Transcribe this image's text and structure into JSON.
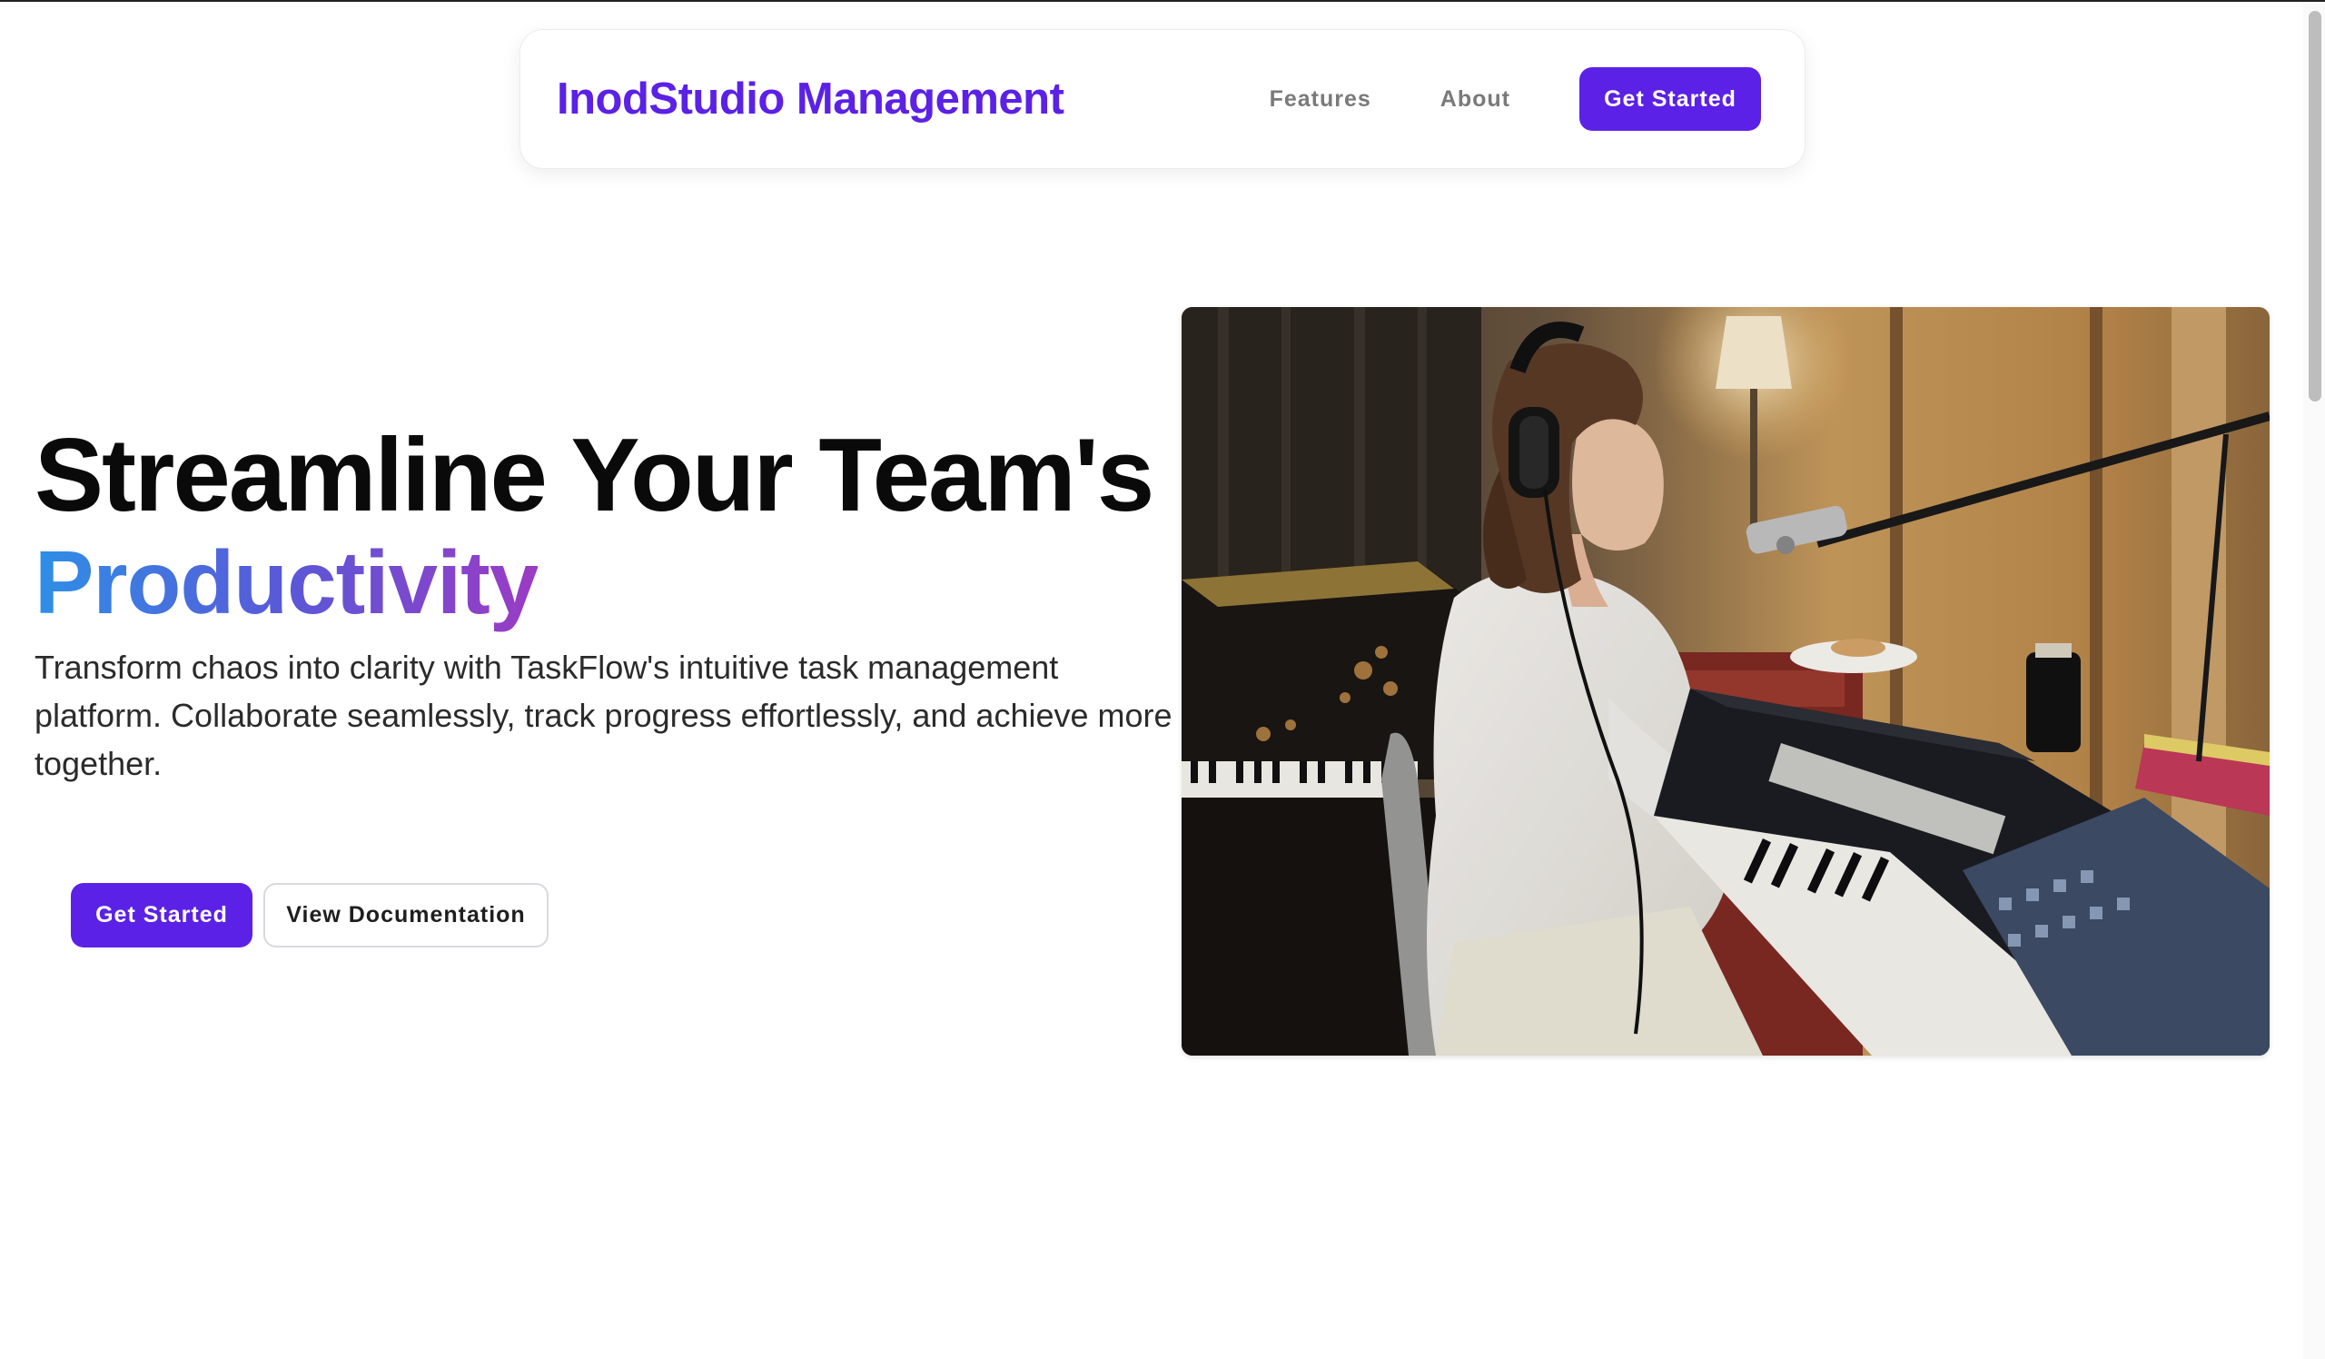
{
  "navbar": {
    "brand": "InodStudio Management",
    "links": [
      "Features",
      "About"
    ],
    "cta_label": "Get Started"
  },
  "hero": {
    "title": "Streamline Your Team's",
    "title_accent": "Productivity",
    "description": "Transform chaos into clarity with TaskFlow's intuitive task management platform. Collaborate seamlessly, track progress effortlessly, and achieve more together.",
    "primary_button": "Get Started",
    "secondary_button": "View Documentation"
  },
  "image": {
    "subject": "woman-with-headphones-playing-keyboard-in-studio"
  },
  "colors": {
    "brand": "#5b21e6",
    "accent_gradient_start": "#2e8fe6",
    "accent_gradient_end": "#9b3bc4",
    "nav_link": "#7a7a7a"
  }
}
